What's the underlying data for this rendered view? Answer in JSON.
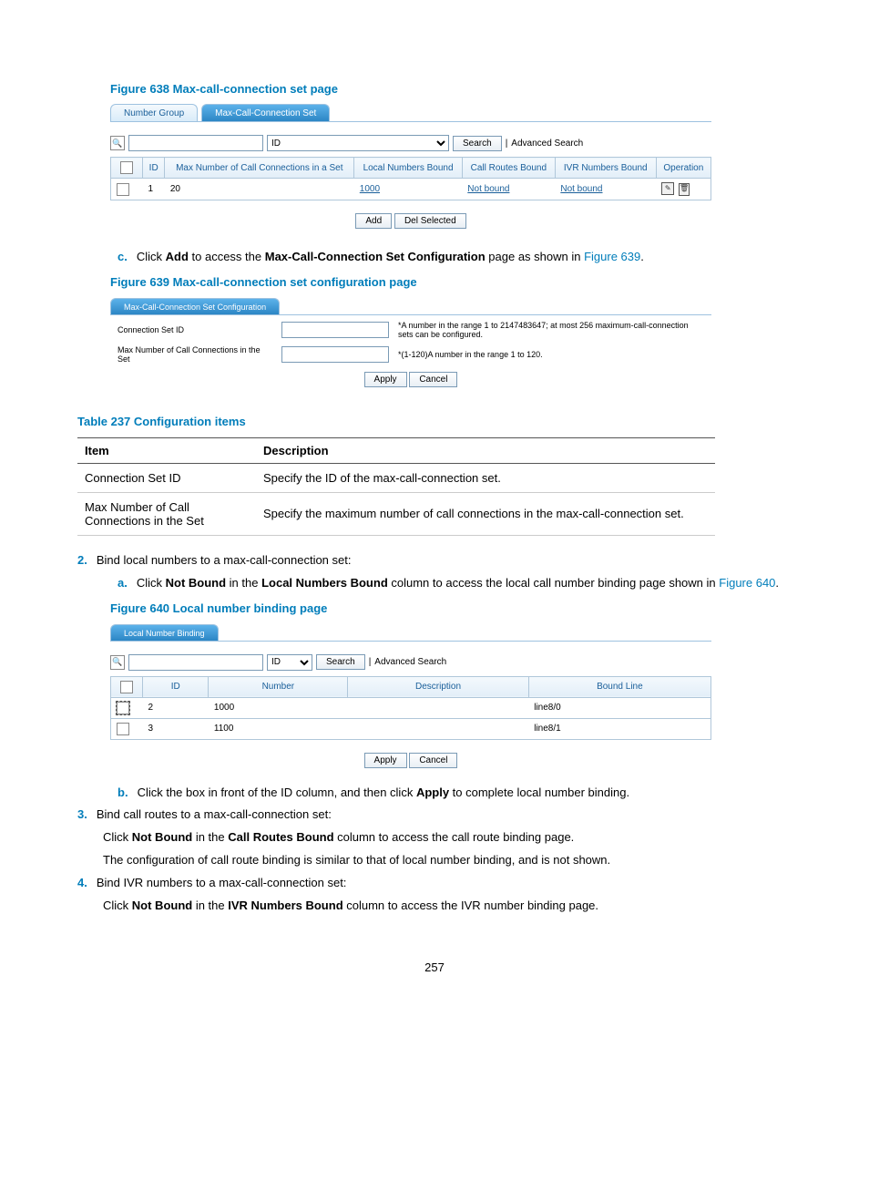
{
  "fig638": {
    "caption": "Figure 638 Max-call-connection set page",
    "tabs": {
      "numberGroup": "Number Group",
      "maxCall": "Max-Call-Connection Set"
    },
    "search": {
      "init_width": "",
      "field": "ID",
      "button": "Search",
      "advanced": "Advanced Search"
    },
    "headers": {
      "id": "ID",
      "max": "Max Number of Call Connections in a Set",
      "local": "Local Numbers Bound",
      "routes": "Call Routes Bound",
      "ivr": "IVR Numbers Bound",
      "op": "Operation"
    },
    "row": {
      "id": "1",
      "max": "20",
      "local": "1000",
      "routes": "Not bound",
      "ivr": "Not bound"
    },
    "buttons": {
      "add": "Add",
      "del": "Del Selected"
    }
  },
  "step_c": {
    "marker": "c.",
    "pre": "Click ",
    "add": "Add",
    "mid": " to access the ",
    "name": "Max-Call-Connection Set Configuration",
    "post": " page as shown in ",
    "link": "Figure 639",
    "dot": "."
  },
  "fig639": {
    "caption": "Figure 639 Max-call-connection set configuration page",
    "tab": "Max-Call-Connection Set Configuration",
    "row1_label": "Connection Set ID",
    "row1_hint": "*A number in the range 1 to 2147483647; at most 256 maximum-call-connection sets can be configured.",
    "row2_label": "Max Number of Call Connections in the Set",
    "row2_hint": "*(1-120)A number in the range 1 to 120.",
    "apply": "Apply",
    "cancel": "Cancel"
  },
  "table237": {
    "caption": "Table 237 Configuration items",
    "th1": "Item",
    "th2": "Description",
    "r1c1": "Connection Set ID",
    "r1c2": "Specify the ID of the max-call-connection set.",
    "r2c1": "Max Number of Call Connections in the Set",
    "r2c2": "Specify the maximum number of call connections in the max-call-connection set."
  },
  "step2": {
    "marker": "2.",
    "text": "Bind local numbers to a max-call-connection set:",
    "a_marker": "a.",
    "a_pre": "Click ",
    "a_nb": "Not Bound",
    "a_mid1": " in the ",
    "a_col": "Local Numbers Bound",
    "a_mid2": " column to access the local call number binding page shown in ",
    "a_link": "Figure 640",
    "a_dot": "."
  },
  "fig640": {
    "caption": "Figure 640 Local number binding page",
    "tab": "Local Number Binding",
    "search": {
      "field": "ID",
      "button": "Search",
      "advanced": "Advanced Search"
    },
    "headers": {
      "id": "ID",
      "number": "Number",
      "desc": "Description",
      "line": "Bound Line"
    },
    "rows": [
      {
        "id": "2",
        "number": "1000",
        "desc": "",
        "line": "line8/0"
      },
      {
        "id": "3",
        "number": "1100",
        "desc": "",
        "line": "line8/1"
      }
    ],
    "apply": "Apply",
    "cancel": "Cancel"
  },
  "step2b": {
    "marker": "b.",
    "pre": "Click the box in front of the ID column, and then click ",
    "apply": "Apply",
    "post": " to complete local number binding."
  },
  "step3": {
    "marker": "3.",
    "text": "Bind call routes to a max-call-connection set:",
    "line2_pre": "Click ",
    "line2_nb": "Not Bound",
    "line2_mid1": " in the ",
    "line2_col": "Call Routes Bound",
    "line2_mid2": " column to access the call route binding page.",
    "line3": "The configuration of call route binding is similar to that of local number binding, and is not shown."
  },
  "step4": {
    "marker": "4.",
    "text": "Bind IVR numbers to a max-call-connection set:",
    "line2_pre": "Click ",
    "line2_nb": "Not Bound",
    "line2_mid1": " in the ",
    "line2_col": "IVR Numbers Bound",
    "line2_mid2": " column to access the IVR number binding page."
  },
  "pageNumber": "257"
}
